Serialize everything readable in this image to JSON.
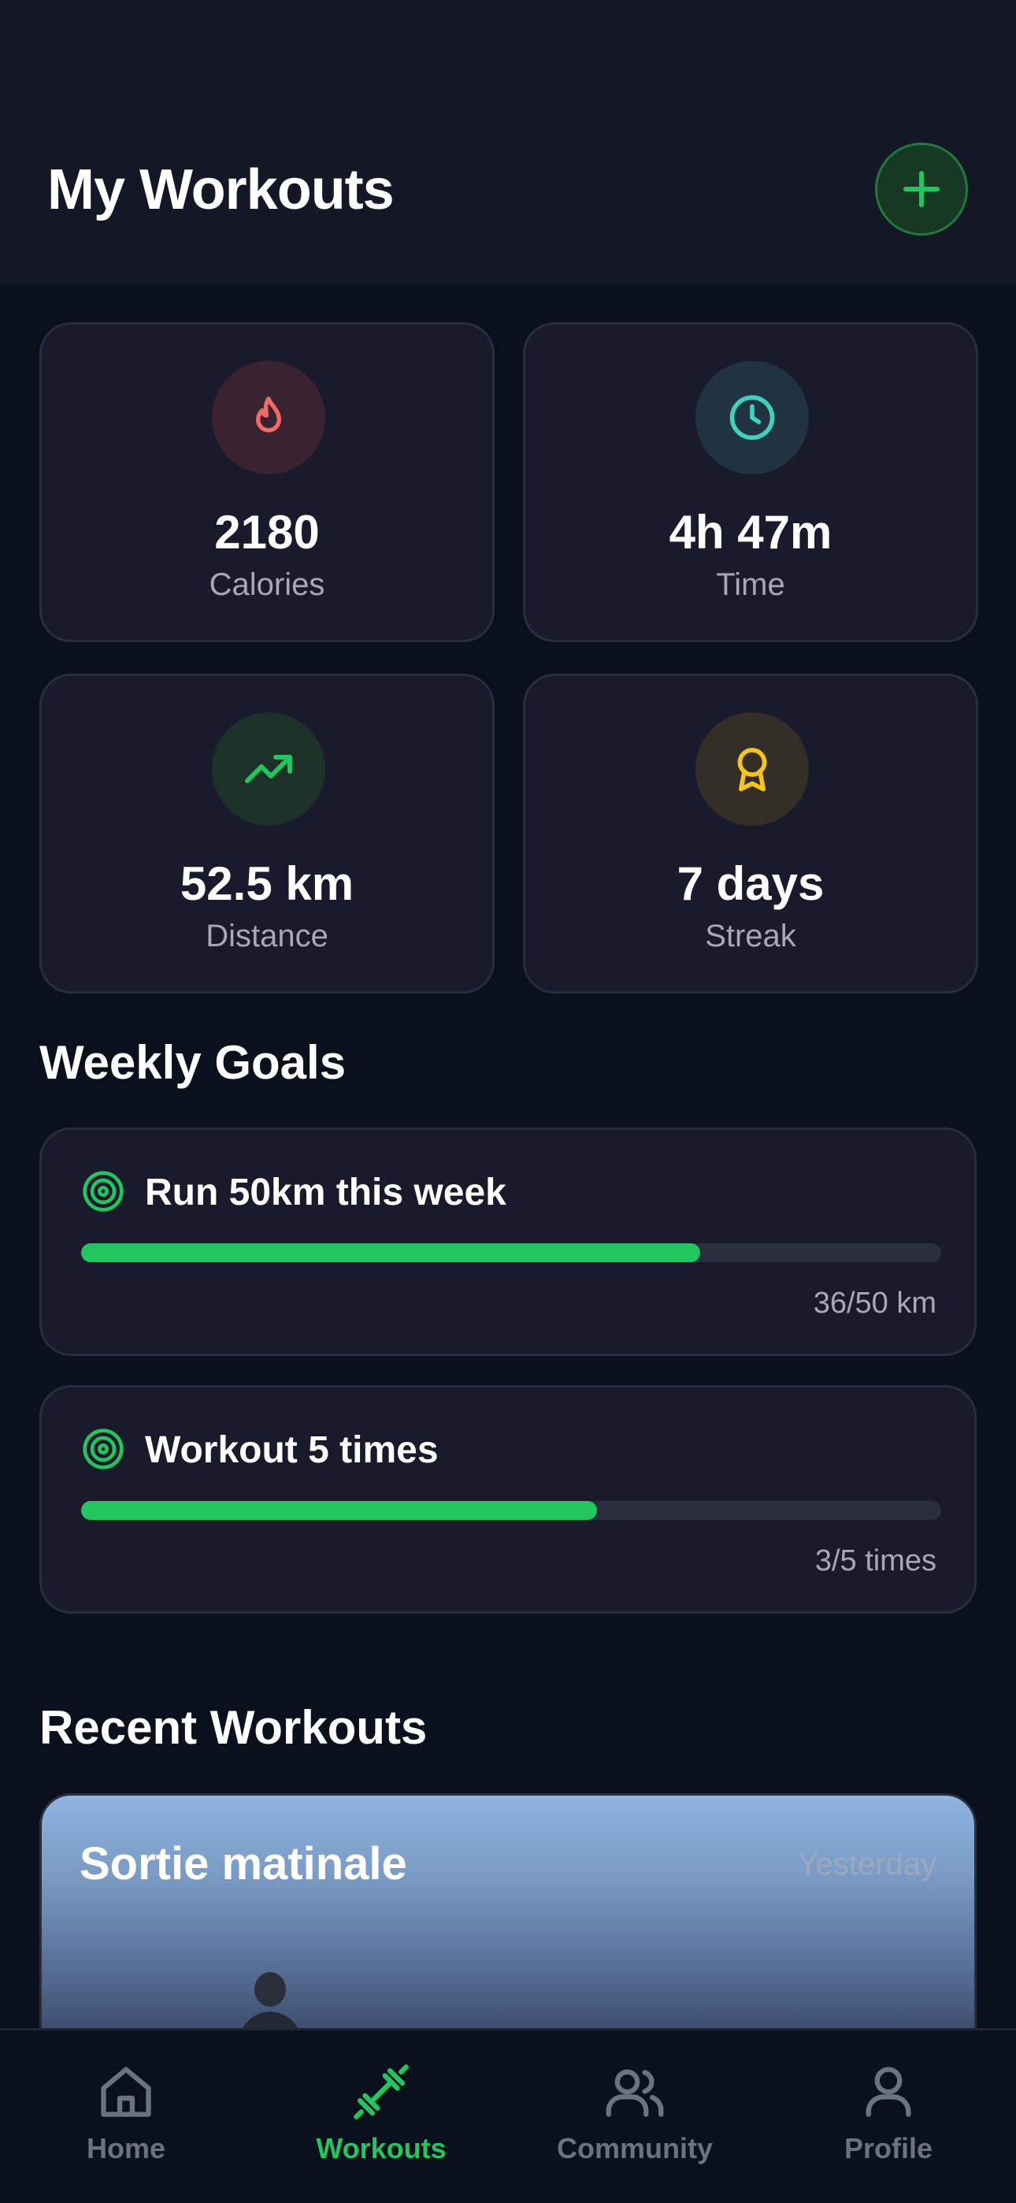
{
  "header": {
    "title": "My Workouts",
    "add_icon": "plus-icon"
  },
  "stats": [
    {
      "value": "2180",
      "label": "Calories",
      "icon": "flame-icon",
      "color": "#f06a6a"
    },
    {
      "value": "4h 47m",
      "label": "Time",
      "icon": "clock-icon",
      "color": "#3fd0c0"
    },
    {
      "value": "52.5 km",
      "label": "Distance",
      "icon": "trending-up-icon",
      "color": "#22c55e"
    },
    {
      "value": "7 days",
      "label": "Streak",
      "icon": "award-icon",
      "color": "#f5c518"
    }
  ],
  "weekly_goals": {
    "title": "Weekly Goals",
    "items": [
      {
        "title": "Run 50km this week",
        "progress_text": "36/50 km",
        "progress": 0.72,
        "icon": "target-icon"
      },
      {
        "title": "Workout 5 times",
        "progress_text": "3/5 times",
        "progress": 0.6,
        "icon": "target-icon"
      }
    ]
  },
  "recent_workouts": {
    "title": "Recent Workouts",
    "items": [
      {
        "name": "Sortie matinale",
        "date": "Yesterday"
      }
    ]
  },
  "tabbar": {
    "items": [
      {
        "label": "Home",
        "icon": "home-icon",
        "active": false
      },
      {
        "label": "Workouts",
        "icon": "dumbbell-icon",
        "active": true
      },
      {
        "label": "Community",
        "icon": "users-icon",
        "active": false
      },
      {
        "label": "Profile",
        "icon": "user-icon",
        "active": false
      }
    ]
  },
  "colors": {
    "accent": "#22c55e",
    "background": "#0b111c",
    "card": "#191a2c"
  }
}
